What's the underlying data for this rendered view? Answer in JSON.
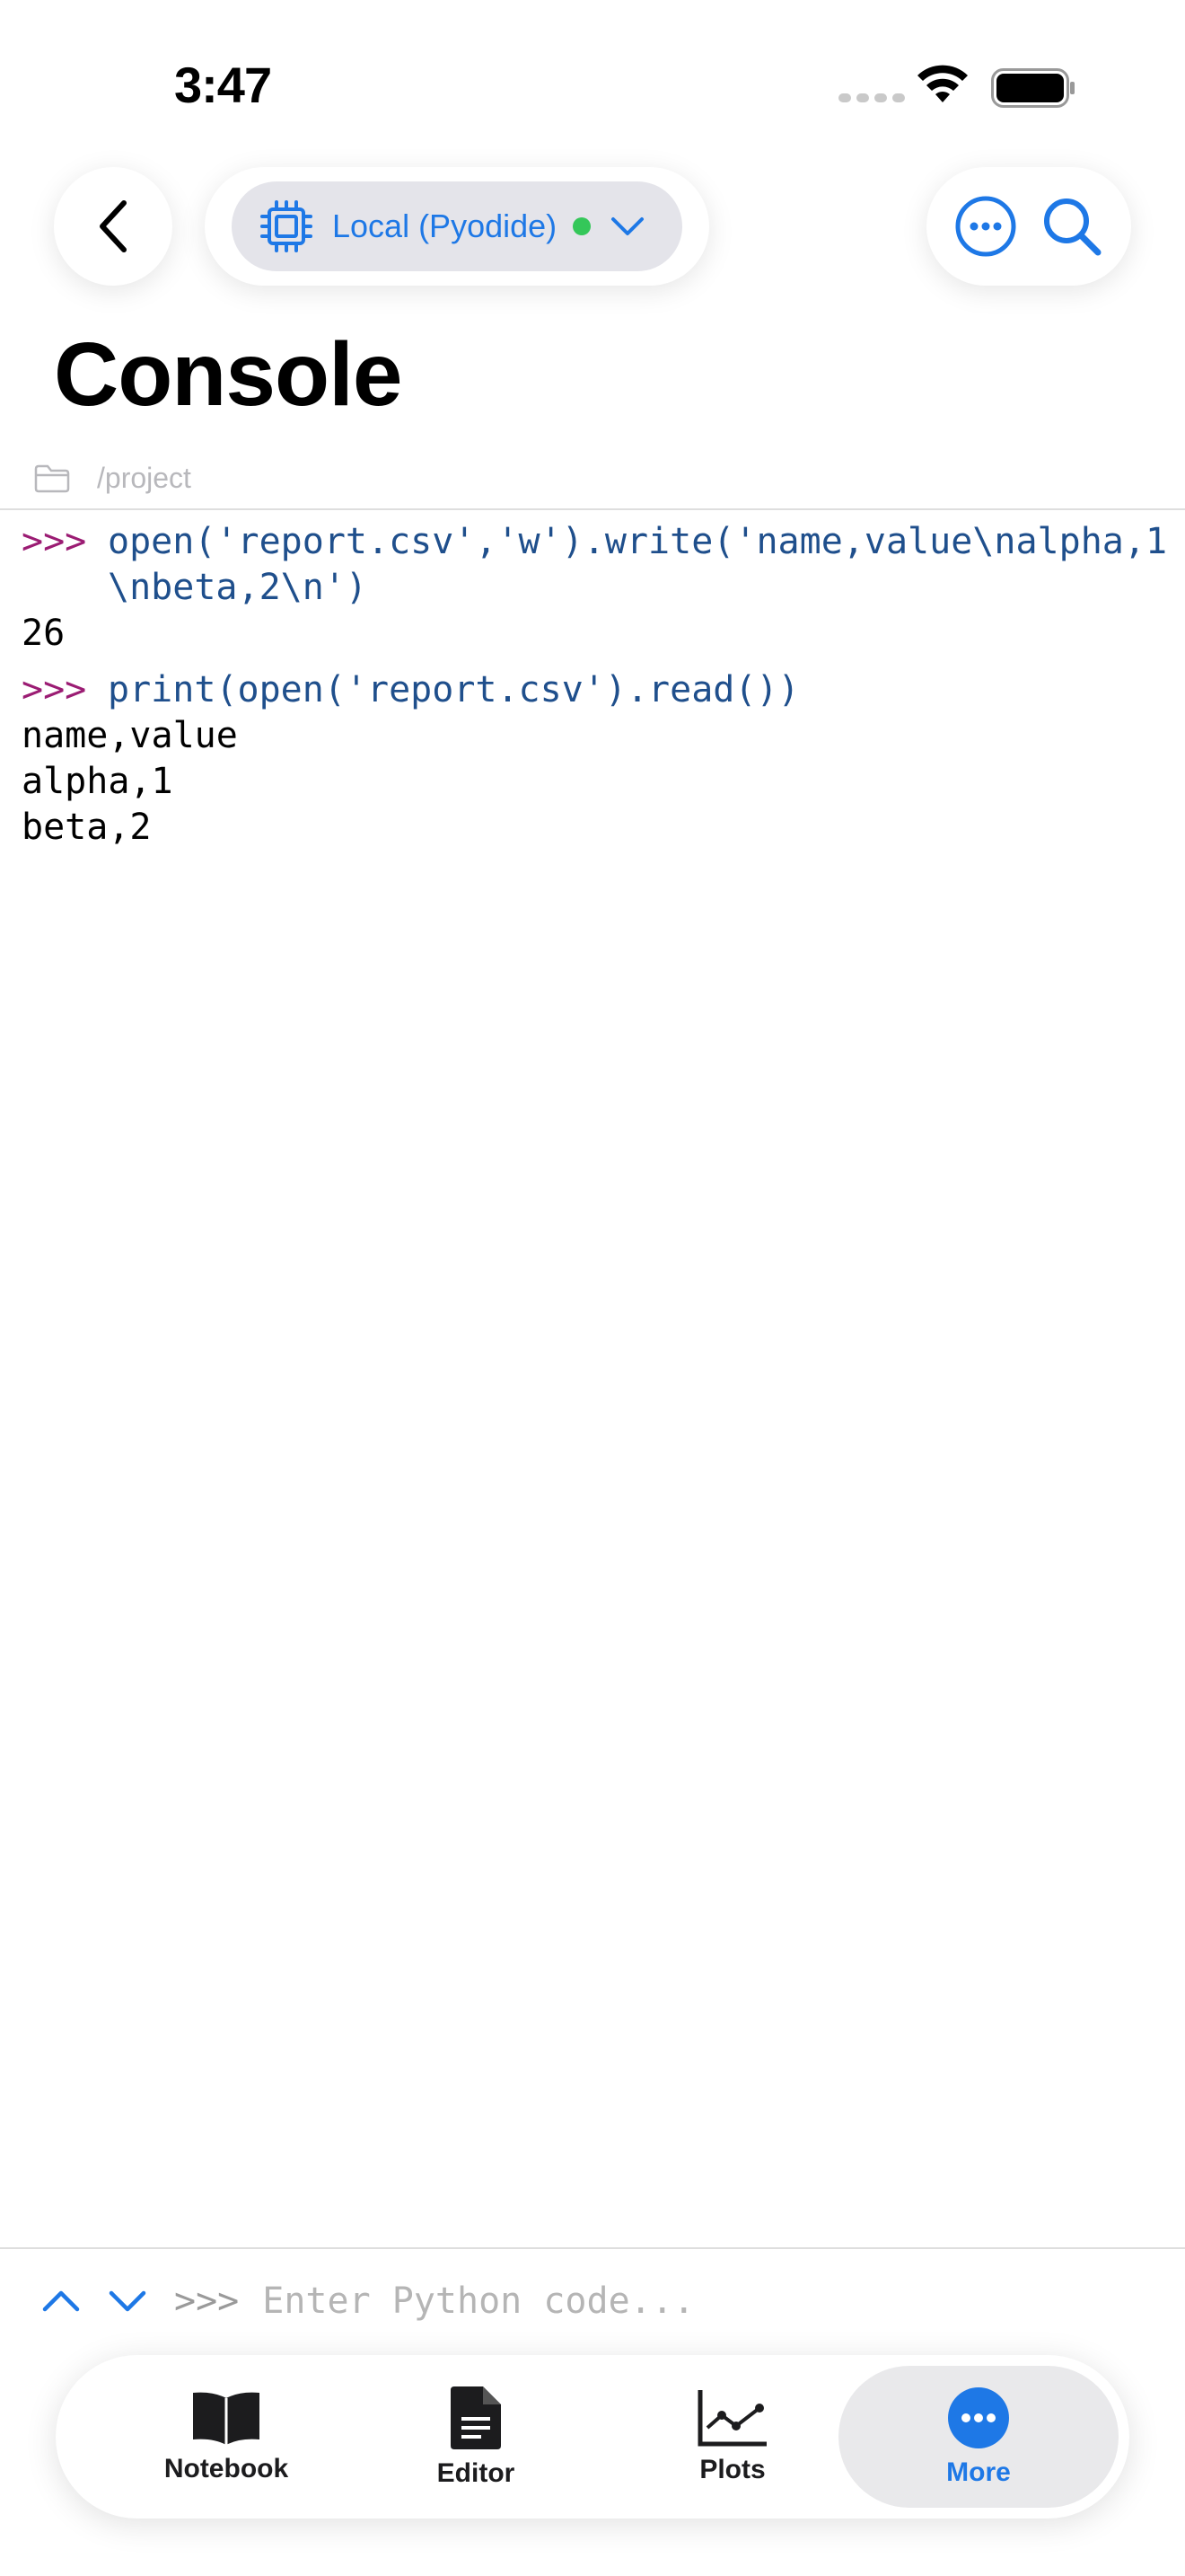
{
  "status_bar": {
    "time": "3:47"
  },
  "toolbar": {
    "kernel_label": "Local (Pyodide)",
    "kernel_status_color": "#34c759",
    "accent_color": "#1e78e6"
  },
  "page": {
    "title": "Console",
    "path": "/project"
  },
  "console": {
    "prompt": ">>>",
    "entries": [
      {
        "input": "open('report.csv','w').write('name,value\\nalpha,1\\nbeta,2\\n')",
        "output": "26"
      },
      {
        "input": "print(open('report.csv').read())",
        "output": "name,value\nalpha,1\nbeta,2"
      }
    ]
  },
  "input": {
    "prompt": ">>>",
    "placeholder": "Enter Python code..."
  },
  "tabs": [
    {
      "label": "Notebook",
      "icon": "book-icon",
      "active": false
    },
    {
      "label": "Editor",
      "icon": "document-icon",
      "active": false
    },
    {
      "label": "Plots",
      "icon": "chart-line-icon",
      "active": false
    },
    {
      "label": "More",
      "icon": "ellipsis-circle-icon",
      "active": true
    }
  ]
}
